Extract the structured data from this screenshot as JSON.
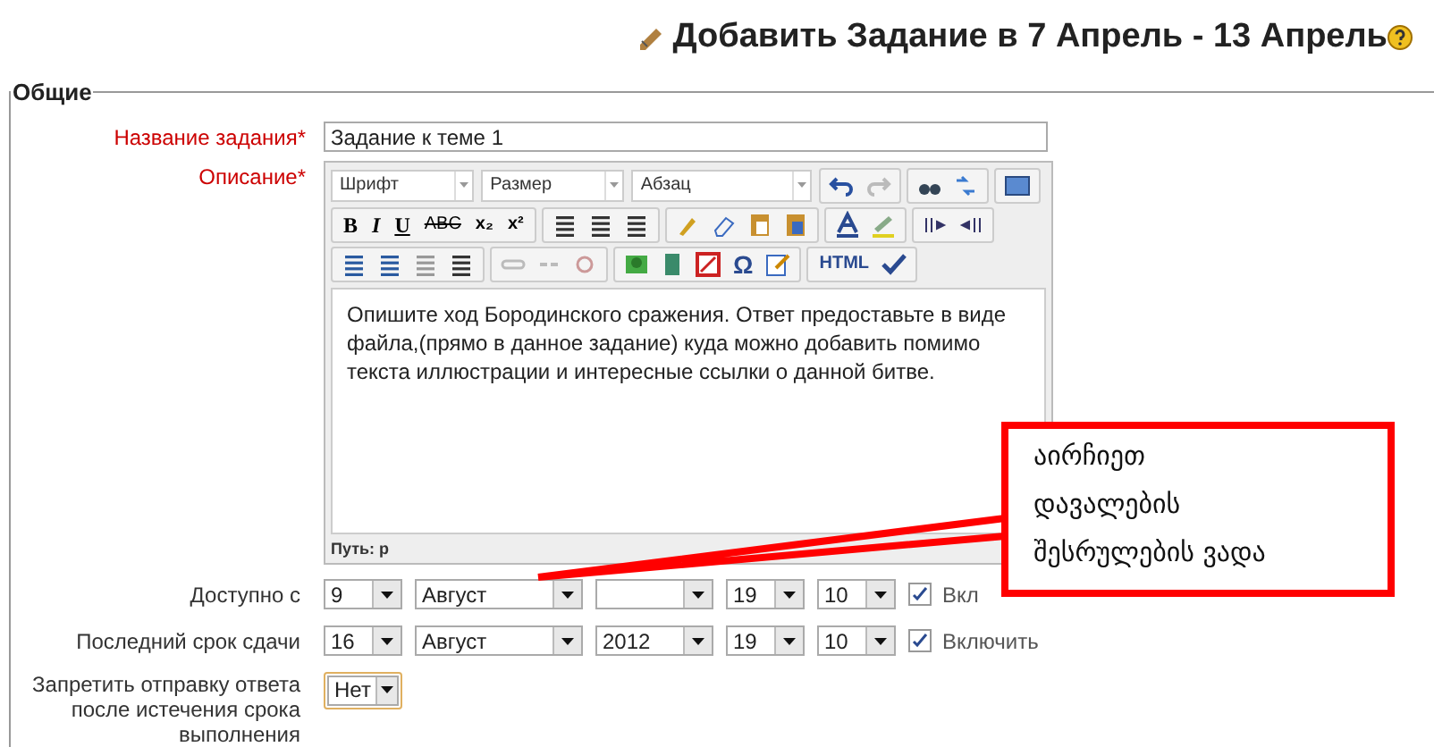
{
  "heading": "Добавить Задание в 7 Апрель - 13 Апрель",
  "legend": "Общие",
  "title_field": {
    "label": "Название задания",
    "required_mark": "*",
    "value": "Задание к теме 1"
  },
  "description": {
    "label": "Описание",
    "required_mark": "*",
    "toolbar": {
      "selects": [
        "Шрифт",
        "Размер",
        "Абзац"
      ],
      "glyphs": [
        "B",
        "I",
        "U",
        "ABC",
        "x₂",
        "x²",
        "Ω",
        "HTML"
      ]
    },
    "text": "Опишите ход Бородинского сражения. Ответ предоставьте в виде файла,(прямо в данное задание) куда можно добавить помимо текста иллюстрации и интересные ссылки о данной битве.",
    "path": "Путь: p"
  },
  "dates": [
    {
      "label": "Доступно с",
      "day": "9",
      "month": "Август",
      "hour": "19",
      "minute": "10",
      "checked": true,
      "enable_label": "Вкл"
    },
    {
      "label": "Последний срок сдачи",
      "day": "16",
      "month": "Август",
      "year": "2012",
      "hour": "19",
      "minute": "10",
      "checked": true,
      "enable_label": "Включить"
    }
  ],
  "restrict": {
    "label": "Запретить отправку ответа после истечения срока выполнения",
    "value": "Нет"
  },
  "callout": {
    "text": "აირჩიეთ დავალების შესრულების ვადა"
  }
}
